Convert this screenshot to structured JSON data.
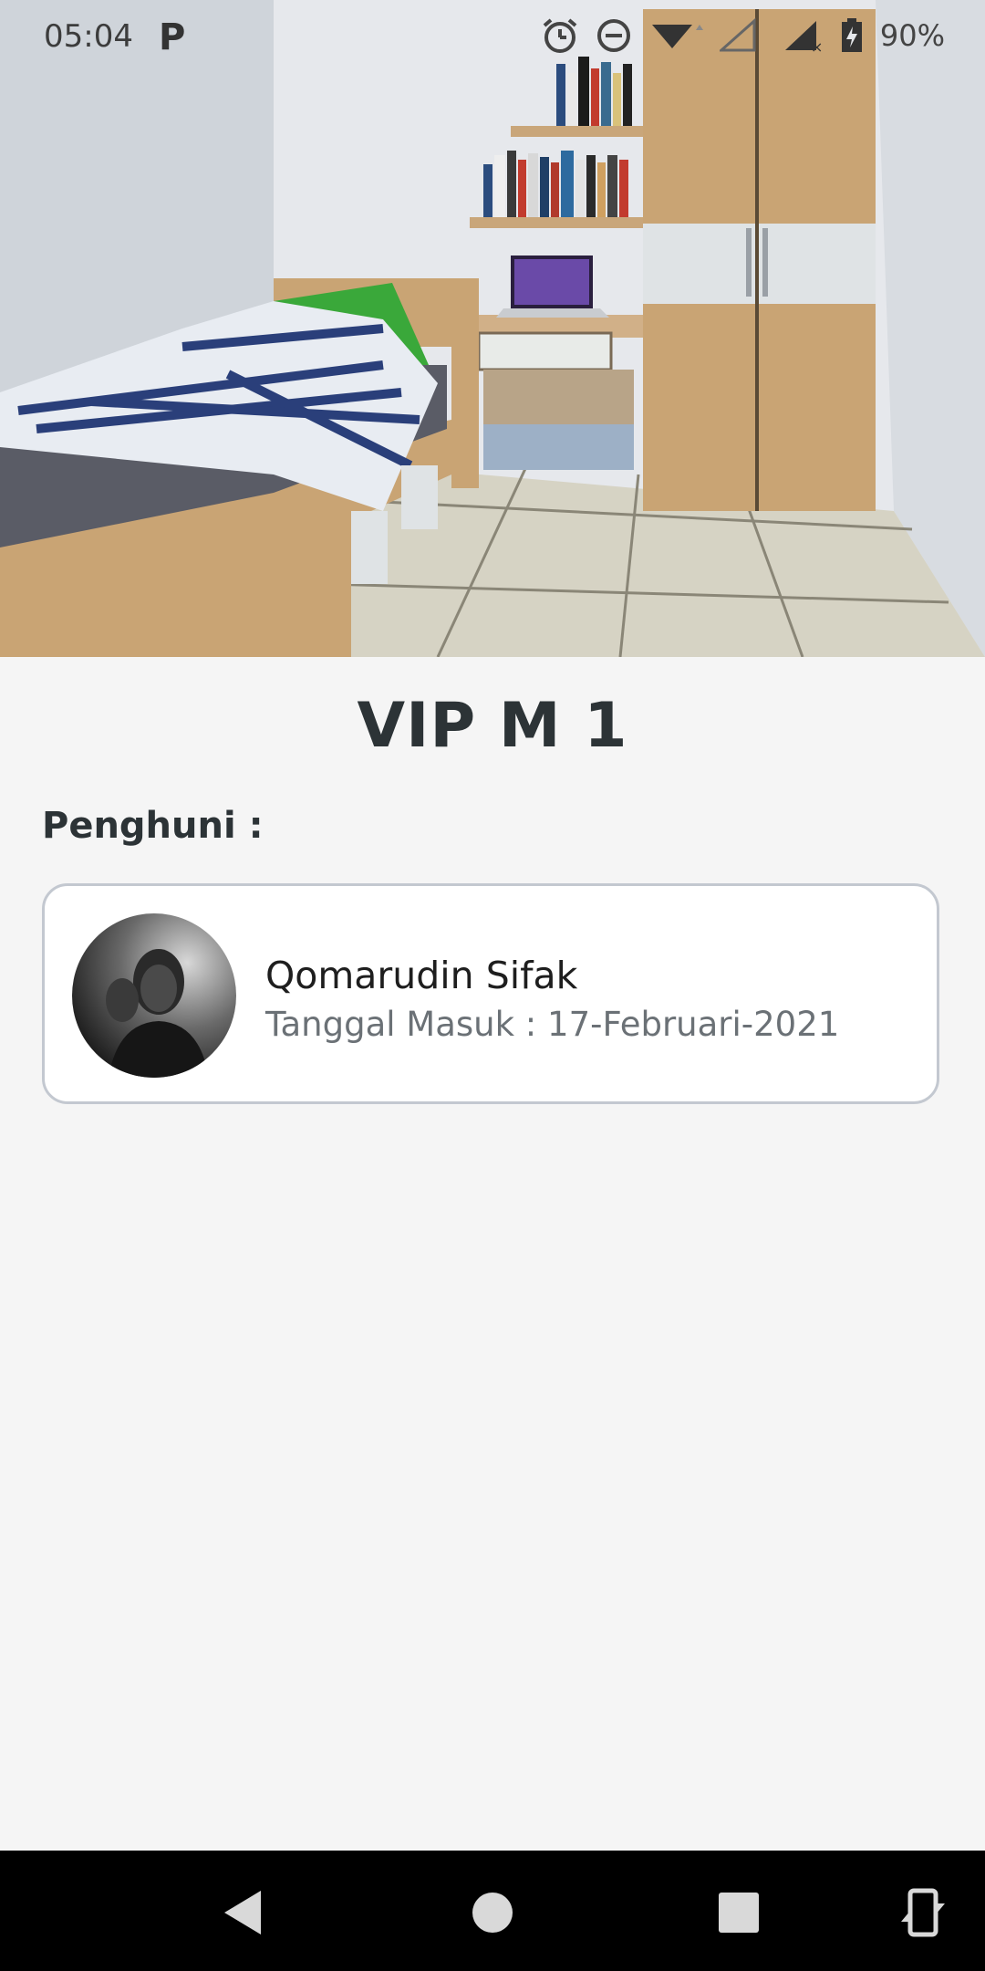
{
  "status_bar": {
    "time": "05:04",
    "app_indicator": "P",
    "icons": [
      "alarm-icon",
      "dnd-icon",
      "wifi-icon",
      "signal-empty-icon",
      "signal-nodata-icon",
      "battery-charging-icon"
    ],
    "battery_percent": "90%"
  },
  "room": {
    "title": "VIP M 1"
  },
  "residents_section": {
    "label": "Penghuni :",
    "residents": [
      {
        "name": "Qomarudin Sifak",
        "entry_date": "Tanggal Masuk : 17-Februari-2021"
      }
    ]
  },
  "nav_bar": {
    "buttons": [
      "back-icon",
      "home-icon",
      "recents-icon",
      "rotate-icon"
    ]
  },
  "colors": {
    "background": "#f5f5f5",
    "title": "#2c3336",
    "card_border": "#c3c8d0",
    "secondary_text": "#6b7176",
    "nav_bar": "#000000"
  }
}
